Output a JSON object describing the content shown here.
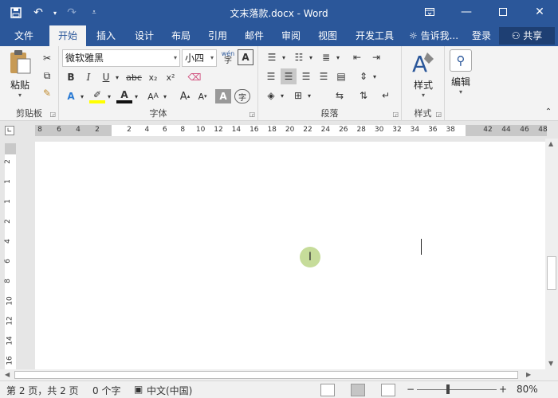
{
  "app": {
    "title": "文末落款.docx - Word",
    "colors": {
      "accent": "#2b579a",
      "page": "#ffffff",
      "canvas": "#e6e6e6"
    }
  },
  "quick_access": {
    "icons": [
      "save-icon",
      "undo-icon",
      "redo-icon",
      "customize-icon"
    ]
  },
  "window_controls": [
    "ribbon-display-icon",
    "minimize-icon",
    "maximize-icon",
    "close-icon"
  ],
  "tabs": [
    {
      "label": "文件"
    },
    {
      "label": "开始"
    },
    {
      "label": "插入"
    },
    {
      "label": "设计"
    },
    {
      "label": "布局"
    },
    {
      "label": "引用"
    },
    {
      "label": "邮件"
    },
    {
      "label": "审阅"
    },
    {
      "label": "视图"
    },
    {
      "label": "开发工具"
    }
  ],
  "active_tab": "开始",
  "tell_me": "告诉我...",
  "login": "登录",
  "share": "共享",
  "clipboard": {
    "paste": "粘贴",
    "group": "剪贴板"
  },
  "font": {
    "name": "微软雅黑",
    "size": "小四",
    "group": "字体",
    "phonetic": "wén",
    "bold": "B",
    "italic": "I",
    "underline": "U",
    "strike": "abc",
    "sub": "x₂",
    "sup": "x²",
    "grow": "A",
    "shrink": "A",
    "color_a": "A",
    "border_a": "A",
    "char_shading": "A",
    "enclosed": "字"
  },
  "paragraph": {
    "group": "段落"
  },
  "styles": {
    "label": "样式",
    "group": "样式"
  },
  "editing": {
    "label": "编辑"
  },
  "ruler": {
    "left_gray": [
      "8",
      "6",
      "4",
      "2"
    ],
    "white": [
      "2",
      "4",
      "6",
      "8",
      "10",
      "12",
      "14",
      "16",
      "18",
      "20",
      "22",
      "24",
      "26",
      "28",
      "30",
      "32",
      "34",
      "36",
      "38"
    ],
    "right_gray": [
      "42",
      "44",
      "46",
      "48"
    ],
    "vertical": [
      "2",
      "1",
      "1",
      "2",
      "4",
      "6",
      "8",
      "10",
      "12",
      "14",
      "16"
    ]
  },
  "status": {
    "page": "第 2 页，共 2 页",
    "words": "0 个字",
    "language": "中文(中国)",
    "zoom": "80%",
    "minus": "−",
    "plus": "+"
  }
}
